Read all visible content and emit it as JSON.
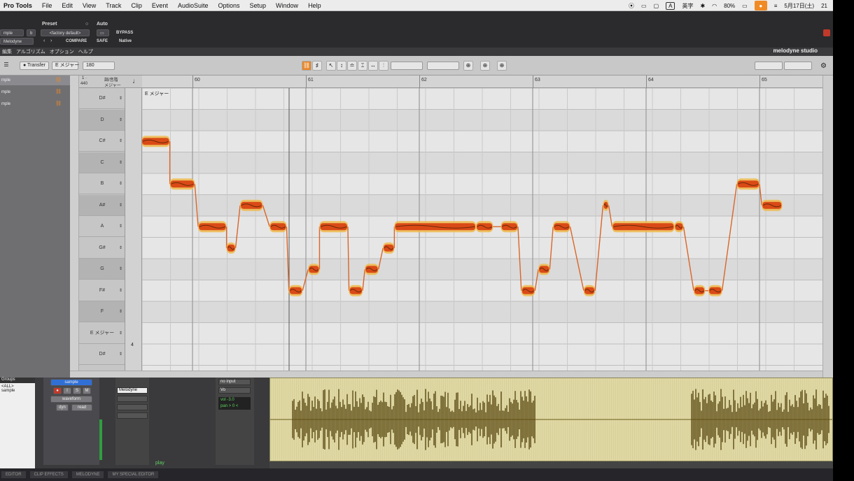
{
  "menubar": {
    "app": "Pro Tools",
    "items": [
      "File",
      "Edit",
      "View",
      "Track",
      "Clip",
      "Event",
      "AudioSuite",
      "Options",
      "Setup",
      "Window",
      "Help"
    ],
    "ime": "A",
    "ime_label": "英字",
    "battery": "80%",
    "date": "5月17日(土)",
    "time": "21"
  },
  "plugin": {
    "track_name": "mple",
    "track_letter": "b",
    "insert_name": "Melodyne",
    "preset_label": "Preset",
    "preset_value": "<factory default>",
    "compare": "COMPARE",
    "auto_label": "Auto",
    "bypass": "BYPASS",
    "safe": "SAFE",
    "native": "Native"
  },
  "mel_menu": {
    "items": [
      "編集",
      "アルゴリズム",
      "オプション",
      "ヘルプ"
    ],
    "logo": "melodyne studio"
  },
  "toolbar": {
    "transfer": "Transfer",
    "key": "E メジャー",
    "tempo": "180"
  },
  "tracklist": {
    "items": [
      {
        "name": "mple"
      },
      {
        "name": "mple"
      },
      {
        "name": "mple"
      }
    ]
  },
  "pitch_header": {
    "top": "1 ·",
    "ref": "440",
    "mode": "調/音階",
    "scale": "メジャー"
  },
  "ruler": {
    "bars": [
      "60",
      "61",
      "62",
      "63",
      "64",
      "65"
    ]
  },
  "grid": {
    "scale_label": "E メジャー"
  },
  "piano": {
    "keys": [
      {
        "n": "D#",
        "black": false
      },
      {
        "n": "D",
        "black": true
      },
      {
        "n": "C#",
        "black": false
      },
      {
        "n": "C",
        "black": true
      },
      {
        "n": "B",
        "black": false
      },
      {
        "n": "A#",
        "black": true
      },
      {
        "n": "A",
        "black": false
      },
      {
        "n": "G#",
        "black": false
      },
      {
        "n": "G",
        "black": true
      },
      {
        "n": "F#",
        "black": false
      },
      {
        "n": "F",
        "black": true
      },
      {
        "n": "E メジャー",
        "black": false
      },
      {
        "n": "D#",
        "black": false
      }
    ],
    "meter_label": "4"
  },
  "notes": [
    {
      "pitch": "E",
      "start": -0.05,
      "len": 0.07
    },
    {
      "pitch": "F#",
      "start": 0.05,
      "len": 0.05
    },
    {
      "pitch": "C#",
      "start": 0.55,
      "len": 0.25
    },
    {
      "pitch": "B",
      "start": 0.8,
      "len": 0.22
    },
    {
      "pitch": "A",
      "start": 1.05,
      "len": 0.25
    },
    {
      "pitch": "G#",
      "start": 1.3,
      "len": 0.08
    },
    {
      "pitch": "A#",
      "start": 1.42,
      "len": 0.2
    },
    {
      "pitch": "A",
      "start": 1.68,
      "len": 0.15
    },
    {
      "pitch": "F#",
      "start": 1.85,
      "len": 0.12
    },
    {
      "pitch": "G",
      "start": 2.02,
      "len": 0.1
    },
    {
      "pitch": "A",
      "start": 2.12,
      "len": 0.25
    },
    {
      "pitch": "F#",
      "start": 2.38,
      "len": 0.12
    },
    {
      "pitch": "G",
      "start": 2.52,
      "len": 0.12
    },
    {
      "pitch": "G#",
      "start": 2.68,
      "len": 0.1
    },
    {
      "pitch": "A",
      "start": 2.78,
      "len": 0.72
    },
    {
      "pitch": "A",
      "start": 3.5,
      "len": 0.15
    },
    {
      "pitch": "A",
      "start": 3.72,
      "len": 0.15
    },
    {
      "pitch": "F#",
      "start": 3.9,
      "len": 0.12
    },
    {
      "pitch": "G",
      "start": 4.05,
      "len": 0.1
    },
    {
      "pitch": "A",
      "start": 4.18,
      "len": 0.15
    },
    {
      "pitch": "F#",
      "start": 4.45,
      "len": 0.1
    },
    {
      "pitch": "A#",
      "start": 4.62,
      "len": 0.05
    },
    {
      "pitch": "A",
      "start": 4.7,
      "len": 0.55
    },
    {
      "pitch": "A",
      "start": 5.25,
      "len": 0.08
    },
    {
      "pitch": "F#",
      "start": 5.42,
      "len": 0.1
    },
    {
      "pitch": "F#",
      "start": 5.55,
      "len": 0.12
    },
    {
      "pitch": "B",
      "start": 5.8,
      "len": 0.2
    },
    {
      "pitch": "A#",
      "start": 6.02,
      "len": 0.18
    }
  ],
  "bottom": {
    "clips_header": "Groups",
    "clips_all": "<ALL>",
    "clips_item": "sample",
    "track_name": "sample",
    "view": "waveform",
    "dyn": "dyn",
    "read": "read",
    "insert": "Melodyne",
    "input": "no input",
    "output": "Vo",
    "vol": "vol  -3.0",
    "pan": "pan  > 0 <",
    "play": "play"
  },
  "status_tabs": [
    "EDITOR",
    "CLIP EFFECTS",
    "MELODYNE",
    "MY SPECIAL EDITOR"
  ],
  "colors": {
    "accent": "#e8872a",
    "note_core": "#d94a16",
    "note_glow": "#f0b94a"
  }
}
